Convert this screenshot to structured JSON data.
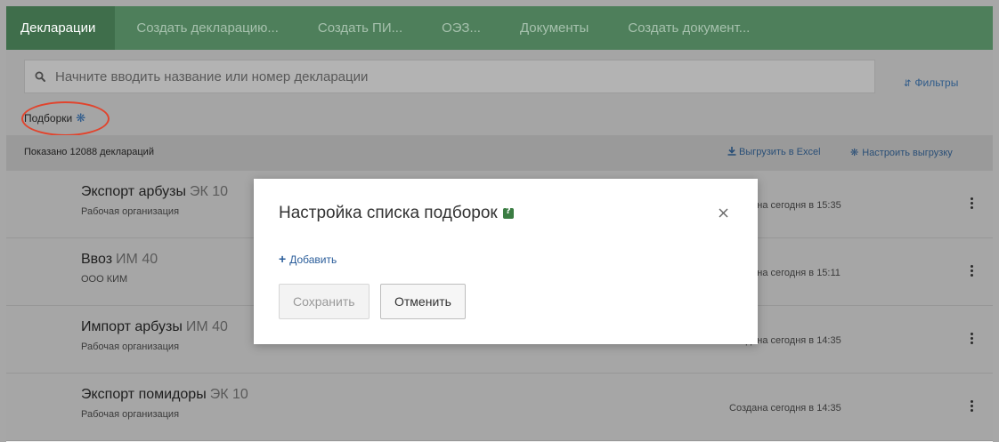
{
  "nav": {
    "tabs": [
      {
        "label": "Декларации"
      },
      {
        "label": "Создать декларацию..."
      },
      {
        "label": "Создать ПИ..."
      },
      {
        "label": "ОЭЗ..."
      },
      {
        "label": "Документы"
      },
      {
        "label": "Создать документ..."
      }
    ]
  },
  "search": {
    "placeholder": "Начните вводить название или номер декларации",
    "value": ""
  },
  "filters_label": "Фильтры",
  "collections_label": "Подборки",
  "summary": {
    "count_text": "Показано 12088 деклараций",
    "excel_label": "Выгрузить в Excel",
    "export_settings_label": "Настроить выгрузку"
  },
  "declarations": [
    {
      "title": "Экспорт арбузы",
      "code": "ЭК 10",
      "org": "Рабочая организация",
      "created": "Создана сегодня в 15:35"
    },
    {
      "title": "Ввоз",
      "code": "ИМ 40",
      "org": "ООО КИМ",
      "created": "Создана сегодня в 15:11"
    },
    {
      "title": "Импорт арбузы",
      "code": "ИМ 40",
      "org": "Рабочая организация",
      "created": "Создана сегодня в 14:35"
    },
    {
      "title": "Экспорт помидоры",
      "code": "ЭК 10",
      "org": "Рабочая организация",
      "created": "Создана сегодня в 14:35"
    }
  ],
  "modal": {
    "title": "Настройка списка подборок",
    "add_label": "Добавить",
    "save_label": "Сохранить",
    "cancel_label": "Отменить"
  },
  "colors": {
    "nav_bg": "#4e7f5b",
    "nav_active_bg": "#3f6e4b",
    "link": "#2a5d9a",
    "highlight_ellipse": "#e1442d",
    "help_icon": "#3b7d43"
  },
  "icons": {
    "search": "search-icon",
    "filters": "sort-icon",
    "collections": "gear-icon",
    "excel": "download-icon",
    "export_settings": "gear-icon",
    "row_menu": "kebab-menu-icon",
    "modal_help": "help-icon",
    "modal_close": "close-icon"
  }
}
